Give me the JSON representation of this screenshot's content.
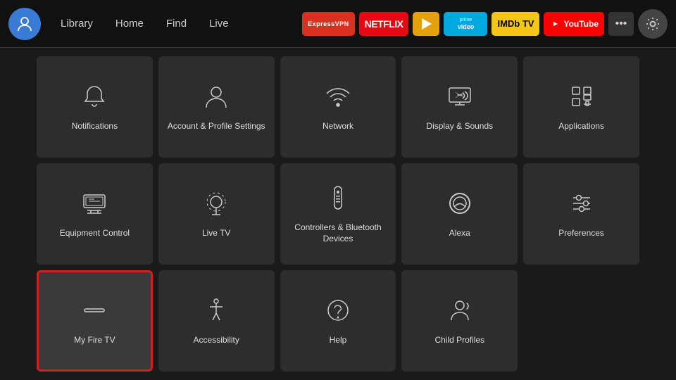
{
  "nav": {
    "links": [
      "Library",
      "Home",
      "Find",
      "Live"
    ],
    "apps": [
      {
        "label": "ExpressVPN",
        "class": "badge-expressvpn"
      },
      {
        "label": "NETFLIX",
        "class": "badge-netflix"
      },
      {
        "label": "▶",
        "class": "badge-plex"
      },
      {
        "label": "prime video",
        "class": "badge-prime"
      },
      {
        "label": "IMDb TV",
        "class": "badge-imdb"
      },
      {
        "label": "▶ YouTube",
        "class": "badge-youtube"
      }
    ]
  },
  "grid": {
    "items": [
      {
        "id": "notifications",
        "label": "Notifications",
        "icon": "bell"
      },
      {
        "id": "account",
        "label": "Account & Profile Settings",
        "icon": "person"
      },
      {
        "id": "network",
        "label": "Network",
        "icon": "wifi"
      },
      {
        "id": "display",
        "label": "Display & Sounds",
        "icon": "display"
      },
      {
        "id": "applications",
        "label": "Applications",
        "icon": "apps"
      },
      {
        "id": "equipment",
        "label": "Equipment Control",
        "icon": "monitor"
      },
      {
        "id": "livetv",
        "label": "Live TV",
        "icon": "antenna"
      },
      {
        "id": "controllers",
        "label": "Controllers & Bluetooth Devices",
        "icon": "remote"
      },
      {
        "id": "alexa",
        "label": "Alexa",
        "icon": "alexa"
      },
      {
        "id": "preferences",
        "label": "Preferences",
        "icon": "sliders"
      },
      {
        "id": "myfiretv",
        "label": "My Fire TV",
        "icon": "firetv",
        "selected": true
      },
      {
        "id": "accessibility",
        "label": "Accessibility",
        "icon": "accessibility"
      },
      {
        "id": "help",
        "label": "Help",
        "icon": "help"
      },
      {
        "id": "childprofiles",
        "label": "Child Profiles",
        "icon": "childprofiles"
      },
      {
        "id": "empty",
        "label": "",
        "icon": "none"
      }
    ]
  }
}
